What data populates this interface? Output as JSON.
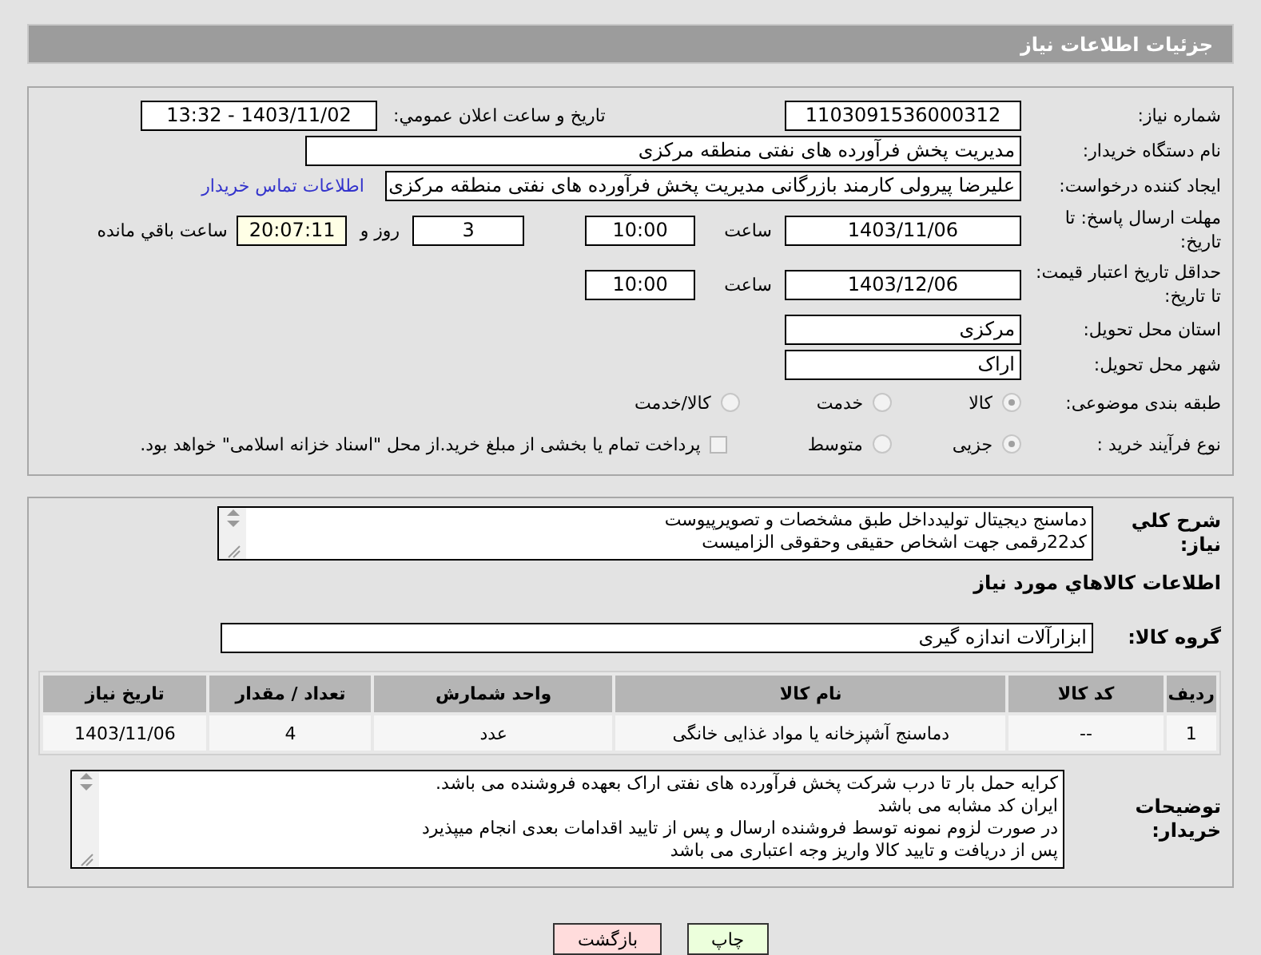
{
  "header": {
    "title": "جزئيات اطلاعات نياز"
  },
  "details": {
    "need_number": {
      "label": "شماره نیاز:",
      "value": "1103091536000312"
    },
    "announce": {
      "label": "تاريخ و ساعت اعلان عمومي:",
      "value": "1403/11/02 - 13:32"
    },
    "buyer_org": {
      "label": "نام دستگاه خریدار:",
      "value": "مدیریت پخش فرآورده های نفتی منطقه مرکزی"
    },
    "requester": {
      "label": "ایجاد کننده درخواست:",
      "value": "علیرضا پیرولی کارمند بازرگانی مدیریت پخش فرآورده های نفتی منطقه مرکزی",
      "link": "اطلاعات تماس خریدار"
    },
    "reply_deadline": {
      "label": "مهلت ارسال پاسخ: تا تاریخ:",
      "date": "1403/11/06",
      "time_label": "ساعت",
      "time": "10:00",
      "days": "3",
      "days_label": "روز و",
      "remaining": "20:07:11",
      "remaining_label": "ساعت باقي مانده"
    },
    "price_validity": {
      "label": "حداقل تاریخ اعتبار قیمت: تا تاریخ:",
      "date": "1403/12/06",
      "time_label": "ساعت",
      "time": "10:00"
    },
    "province": {
      "label": "استان محل تحویل:",
      "value": "مرکزی"
    },
    "city": {
      "label": "شهر محل تحویل:",
      "value": "اراک"
    },
    "category": {
      "label": "طبقه بندی موضوعی:",
      "options": [
        {
          "label": "کالا",
          "selected": true,
          "disabled": true
        },
        {
          "label": "خدمت",
          "selected": false,
          "disabled": true
        },
        {
          "label": "کالا/خدمت",
          "selected": false,
          "disabled": true
        }
      ]
    },
    "process": {
      "label": "نوع فرآیند خرید :",
      "options": [
        {
          "label": "جزیی",
          "selected": true,
          "disabled": true
        },
        {
          "label": "متوسط",
          "selected": false,
          "disabled": true
        }
      ],
      "treasury": {
        "label": "پرداخت تمام یا بخشی از مبلغ خرید.از محل \"اسناد خزانه اسلامی\" خواهد بود.",
        "checked": false
      }
    }
  },
  "goods": {
    "description": {
      "label": "شرح کلي نياز:",
      "lines": [
        "دماسنج دیجیتال تولیدداخل طبق مشخصات و تصویرپیوست",
        "کد22رقمی  جهت اشخاص حقیقی وحقوقی الزامیست"
      ]
    },
    "title": "اطلاعات کالاهاي مورد نياز",
    "group": {
      "label": "گروه کالا:",
      "value": "ابزارآلات اندازه گیری"
    },
    "table": {
      "columns": [
        "ردیف",
        "کد کالا",
        "نام کالا",
        "واحد شمارش",
        "تعداد / مقدار",
        "تاریخ نیاز"
      ],
      "rows": [
        [
          "1",
          "--",
          "دماسنج آشپزخانه یا مواد غذایی خانگی",
          "عدد",
          "4",
          "1403/11/06"
        ]
      ]
    },
    "notes": {
      "label": "توضیحات خریدار:",
      "lines": [
        "کرایه حمل بار تا درب شرکت  پخش فرآورده های نفتی اراک بعهده فروشنده می باشد.",
        "ایران کد مشابه می باشد",
        "در صورت لزوم نمونه توسط فروشنده ارسال و پس از تایید اقدامات بعدی انجام میپذیرد",
        "پس از دریافت و تایید کالا واریز وجه اعتباری می باشد"
      ]
    }
  },
  "buttons": [
    {
      "label": "چاپ",
      "kind": "print"
    },
    {
      "label": "بازگشت",
      "kind": "back"
    }
  ]
}
